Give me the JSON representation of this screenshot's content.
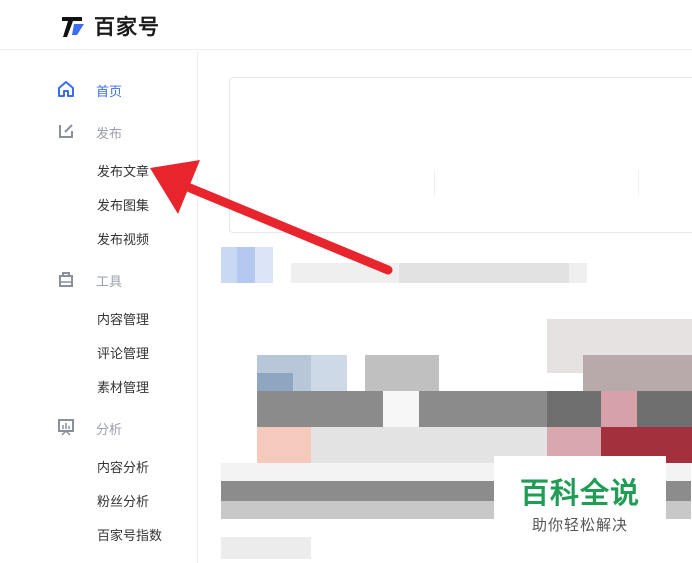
{
  "header": {
    "brand": "百家号"
  },
  "sidebar": {
    "home_label": "首页",
    "publish_label": "发布",
    "publish_items": [
      "发布文章",
      "发布图集",
      "发布视频"
    ],
    "tools_label": "工具",
    "tools_items": [
      "内容管理",
      "评论管理",
      "素材管理"
    ],
    "analysis_label": "分析",
    "analysis_items": [
      "内容分析",
      "粉丝分析",
      "百家号指数"
    ]
  },
  "watermark": {
    "title": "百科全说",
    "subtitle": "助你轻松解决"
  },
  "colors": {
    "accent": "#3a6df0",
    "arrow": "#e8242c",
    "watermark_green": "#1f9d55"
  }
}
